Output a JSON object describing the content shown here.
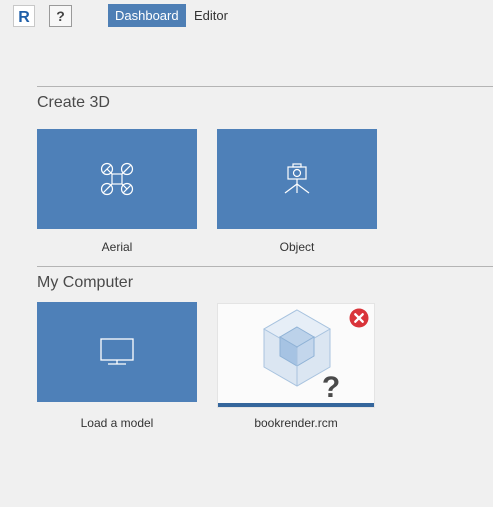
{
  "header": {
    "logo_letter": "R",
    "help_label": "?",
    "tabs": [
      {
        "label": "Dashboard",
        "active": true
      },
      {
        "label": "Editor",
        "active": false
      }
    ]
  },
  "create3d": {
    "title": "Create 3D",
    "tiles": [
      {
        "label": "Aerial",
        "icon": "drone-icon"
      },
      {
        "label": "Object",
        "icon": "camera-tripod-icon"
      }
    ]
  },
  "my_computer": {
    "title": "My Computer",
    "load": {
      "label": "Load a model",
      "icon": "monitor-icon"
    },
    "recent": [
      {
        "name": "bookrender.rcm",
        "thumbnail_icon": "cube-icon",
        "status_icon": "question-mark-icon",
        "remove_icon": "close-circle-icon"
      }
    ]
  },
  "colors": {
    "accent": "#4e7fb5",
    "tile_bg": "#4e80b8",
    "remove_red": "#d9343a",
    "progress_bar": "#35669c",
    "background": "#f0f0f0"
  }
}
